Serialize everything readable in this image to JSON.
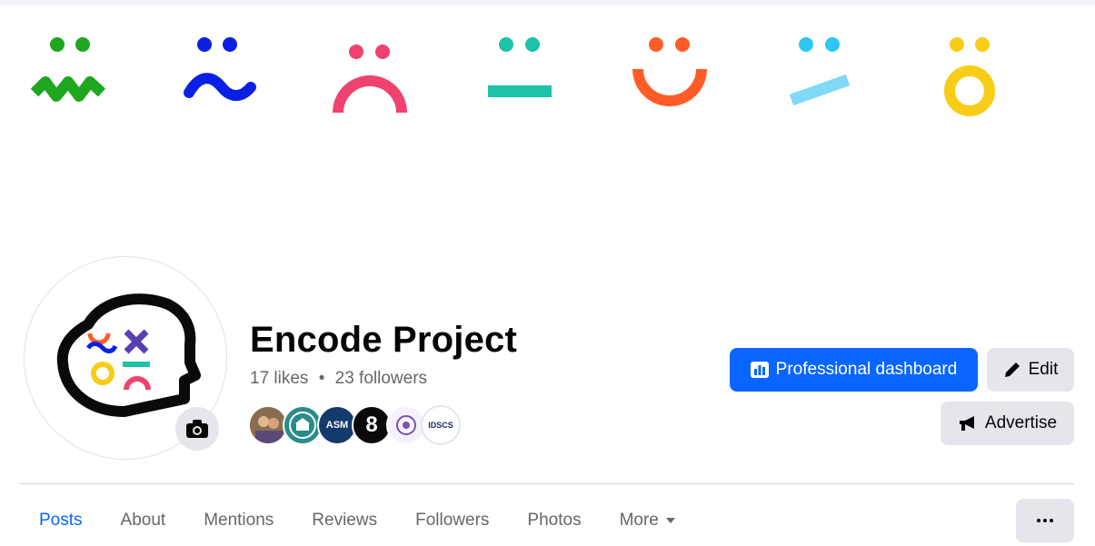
{
  "page": {
    "name": "Encode Project",
    "likes": "17 likes",
    "separator": "•",
    "followers": "23 followers"
  },
  "actions": {
    "professional_dashboard": "Professional dashboard",
    "edit": "Edit",
    "advertise": "Advertise"
  },
  "friends": [
    {
      "label": ""
    },
    {
      "label": ""
    },
    {
      "label": "ASM"
    },
    {
      "label": "8"
    },
    {
      "label": ""
    },
    {
      "label": "IDSCS"
    }
  ],
  "tabs": [
    {
      "label": "Posts",
      "active": true
    },
    {
      "label": "About"
    },
    {
      "label": "Mentions"
    },
    {
      "label": "Reviews"
    },
    {
      "label": "Followers"
    },
    {
      "label": "Photos"
    },
    {
      "label": "More"
    }
  ],
  "colors": {
    "primary": "#0866ff",
    "secondary_bg": "#e4e6eb",
    "muted_text": "#65676b",
    "face_green": "#1fa61f",
    "face_blue": "#0a1fe6",
    "face_pink": "#f0426e",
    "face_teal": "#1dc3a7",
    "face_orange": "#ff5c28",
    "face_cyan": "#2ec7f5",
    "face_yellow": "#f7cd17"
  },
  "icons": {
    "camera": "camera-icon",
    "dashboard": "bar-chart-icon",
    "edit": "pencil-icon",
    "advertise": "megaphone-icon",
    "more": "caret-down-icon",
    "overflow": "ellipsis-icon"
  }
}
